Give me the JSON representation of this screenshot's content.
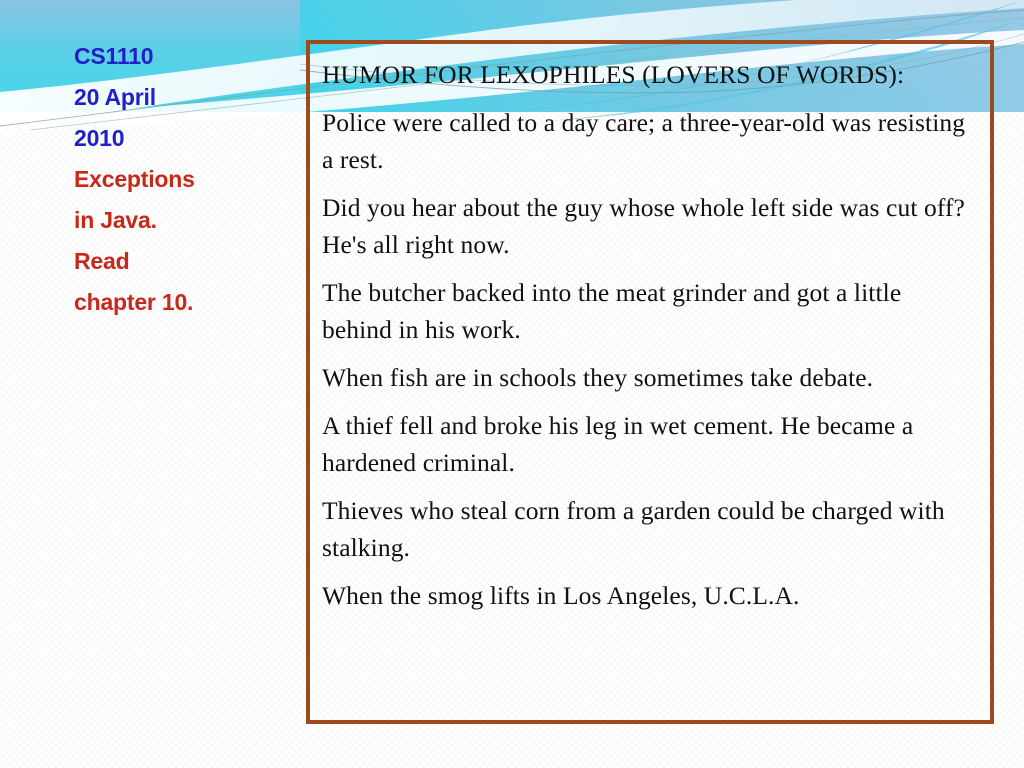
{
  "slide": {
    "theme": {
      "accent_cyan": "#4FD3E8",
      "accent_blue": "#7FB8DC",
      "border_brown": "#9C4A1E",
      "title_blue": "#2020C8",
      "title_red": "#C8281A",
      "background": "#FFFFFF",
      "body_text": "#111111"
    }
  },
  "sidebar": {
    "lines": [
      {
        "text": "CS1110",
        "color_role": "blue"
      },
      {
        "text": "20 April",
        "color_role": "blue"
      },
      {
        "text": "2010",
        "color_role": "blue"
      },
      {
        "text": "Exceptions",
        "color_role": "red"
      },
      {
        "text": "in Java.",
        "color_role": "red"
      },
      {
        "text": "Read",
        "color_role": "red"
      },
      {
        "text": "chapter 10.",
        "color_role": "red"
      }
    ]
  },
  "content": {
    "heading": "HUMOR FOR LEXOPHILES (LOVERS OF WORDS):",
    "jokes": [
      {
        "line1": "Police were called to a day care; a three-year-old was resisting a rest.",
        "line2": ""
      },
      {
        "line1": "Did you hear about the guy whose whole left side was cut off?",
        "line2": "He's all right now."
      },
      {
        "line1": "The butcher backed into the meat grinder and got a little behind in his work.",
        "line2": ""
      },
      {
        "line1": "When fish are in schools they sometimes take debate.",
        "line2": ""
      },
      {
        "line1": "A thief fell and broke his leg in wet cement. He became a hardened criminal.",
        "line2": ""
      },
      {
        "line1": "Thieves who steal corn from a garden could be charged with stalking.",
        "line2": ""
      },
      {
        "line1": "When the smog lifts in Los Angeles, U.C.L.A.",
        "line2": ""
      }
    ]
  }
}
